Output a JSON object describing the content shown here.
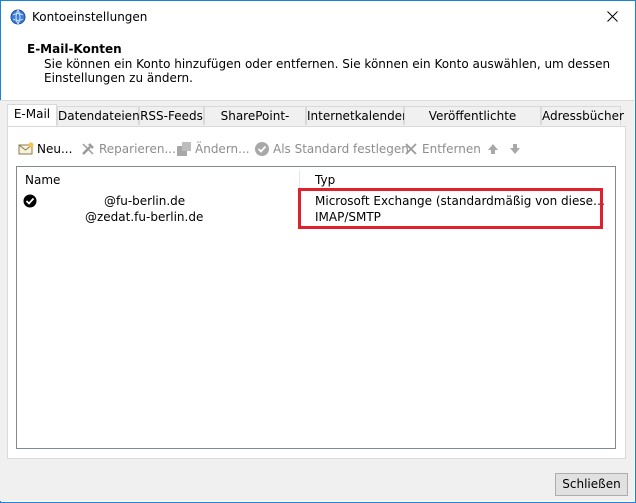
{
  "window": {
    "title": "Kontoeinstellungen"
  },
  "header": {
    "title": "E-Mail-Konten",
    "description": "Sie können ein Konto hinzufügen oder entfernen. Sie können ein Konto auswählen, um dessen Einstellungen zu ändern."
  },
  "tabs": [
    {
      "label": "E-Mail"
    },
    {
      "label": "Datendateien"
    },
    {
      "label": "RSS-Feeds"
    },
    {
      "label": "SharePoint-Listen"
    },
    {
      "label": "Internetkalender"
    },
    {
      "label": "Veröffentlichte Kalender"
    },
    {
      "label": "Adressbücher"
    }
  ],
  "toolbar": {
    "new_label": "Neu...",
    "repair_label": "Reparieren...",
    "change_label": "Ändern...",
    "default_label": "Als Standard festlegen",
    "remove_label": "Entfernen"
  },
  "list": {
    "col_name": "Name",
    "col_type": "Typ",
    "rows": [
      {
        "name": "@fu-berlin.de",
        "type": "Microsoft Exchange (standardmäßig von diesem Kon..."
      },
      {
        "name": "@zedat.fu-berlin.de",
        "type": "IMAP/SMTP"
      }
    ]
  },
  "footer": {
    "close_label": "Schließen"
  },
  "colors": {
    "accent": "#1883d7",
    "highlight": "#e0202c"
  }
}
